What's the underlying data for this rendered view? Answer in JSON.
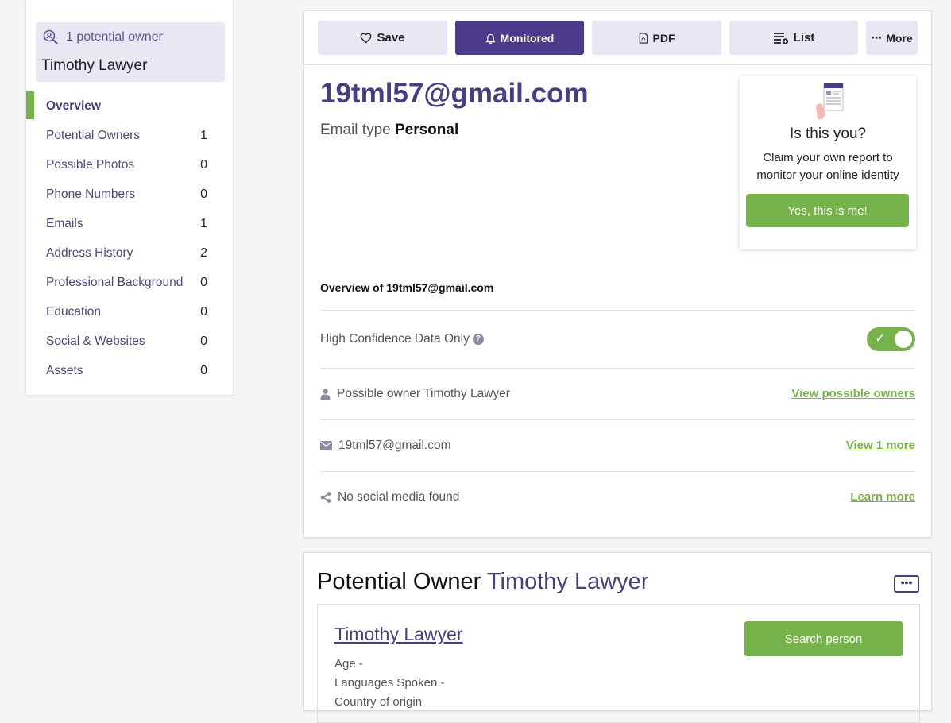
{
  "sidebar": {
    "owner_count_label": "1 potential owner",
    "owner_name": "Timothy Lawyer",
    "items": [
      {
        "label": "Overview",
        "count": ""
      },
      {
        "label": "Potential Owners",
        "count": "1"
      },
      {
        "label": "Possible Photos",
        "count": "0"
      },
      {
        "label": "Phone Numbers",
        "count": "0"
      },
      {
        "label": "Emails",
        "count": "1"
      },
      {
        "label": "Address History",
        "count": "2"
      },
      {
        "label": "Professional Background",
        "count": "0"
      },
      {
        "label": "Education",
        "count": "0"
      },
      {
        "label": "Social & Websites",
        "count": "0"
      },
      {
        "label": "Assets",
        "count": "0"
      }
    ]
  },
  "toolbar": {
    "save": "Save",
    "monitored": "Monitored",
    "pdf": "PDF",
    "list": "List",
    "more": "More"
  },
  "report": {
    "email": "19tml57@gmail.com",
    "email_type_label": "Email type",
    "email_type_value": "Personal",
    "overview_heading": "Overview of 19tml57@gmail.com",
    "high_confidence_label": "High Confidence Data Only",
    "high_confidence_on": true,
    "possible_owner_text": "Possible owner Timothy Lawyer",
    "possible_owner_link": "View possible owners",
    "email_row_text": "19tml57@gmail.com",
    "email_row_link": "View 1 more",
    "social_text": "No social media found",
    "social_link": "Learn more"
  },
  "claim": {
    "title": "Is this you?",
    "text": "Claim your own report to monitor your online identity",
    "button": "Yes, this is me!"
  },
  "potential_owner": {
    "heading_prefix": "Potential Owner",
    "heading_name": "Timothy Lawyer",
    "person_name": "Timothy Lawyer",
    "search_button": "Search person",
    "age": "Age -",
    "languages": "Languages Spoken -",
    "country": "Country of origin"
  },
  "colors": {
    "brand_purple": "#473d80",
    "primary_button": "#4b3b8a",
    "accent_green": "#76b34b"
  }
}
